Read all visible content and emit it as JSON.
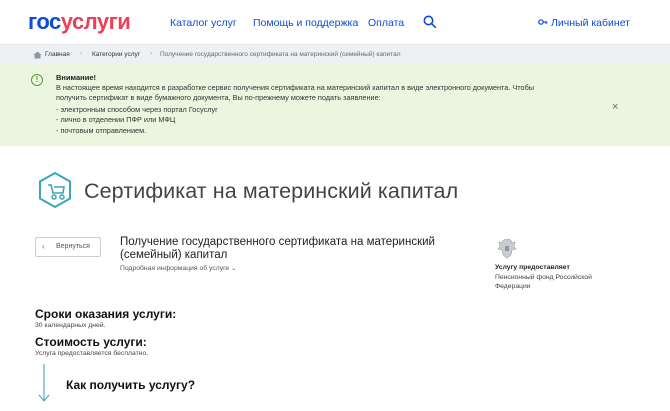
{
  "header": {
    "logo_part1": "гос",
    "logo_part2": "услуги",
    "nav": [
      "Каталог услуг",
      "Помощь и поддержка",
      "Оплата"
    ],
    "cabinet_label": "Личный кабинет"
  },
  "breadcrumb": [
    "Главная",
    "Категории услуг",
    "Получение государственного сертификата на материнский (семейный) капитал"
  ],
  "notice": {
    "title": "Внимание!",
    "text": "В настоящее время находится в разработке сервис получения сертификата на материнский капитал в виде электронного документа. Чтобы получить сертификат в виде бумажного документа, Вы по-прежнему можете подать заявление:",
    "items": [
      "- электронным способом через портал Госуслуг",
      "- лично в отделении ПФР или МФЦ",
      "- почтовым отправлением."
    ],
    "close": "×"
  },
  "page_title": "Сертификат на материнский капитал",
  "back_label": "Вернуться",
  "service": {
    "title": "Получение государственного сертификата на материнский (семейный) капитал",
    "more_info": "Подробная информация об услуге"
  },
  "provider": {
    "label": "Услугу предоставляет",
    "name": "Пенсионный фонд Российской Федерации"
  },
  "terms": {
    "heading": "Сроки оказания услуги:",
    "value": "30 календарных дней."
  },
  "cost": {
    "heading": "Стоимость услуги:",
    "value": "Услуга предоставляется бесплатно."
  },
  "how_heading": "Как получить услугу?",
  "colors": {
    "brand_blue": "#0d4cd3",
    "brand_red": "#ee3f58",
    "notice_bg": "#eaf6e0",
    "accent_teal": "#3aa7b6"
  }
}
